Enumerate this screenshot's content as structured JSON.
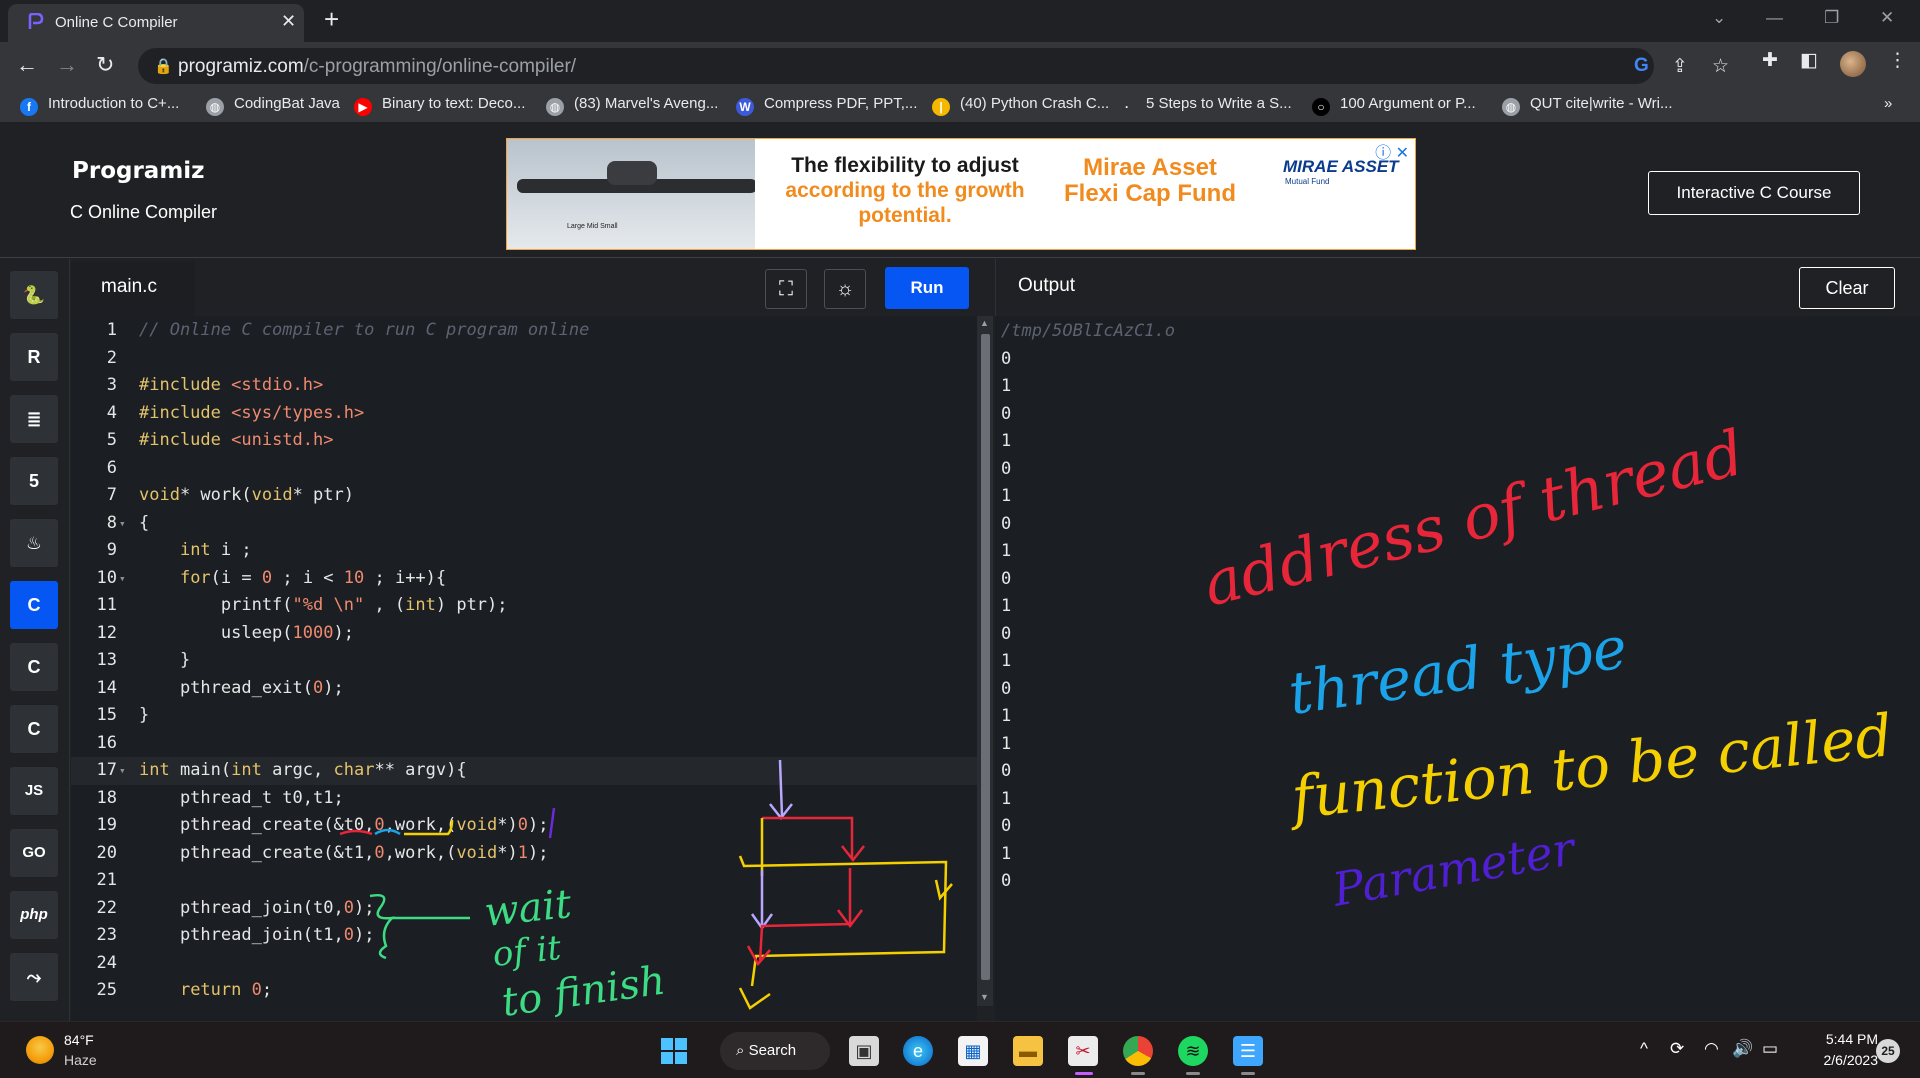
{
  "browser": {
    "tab_title": "Online C Compiler",
    "tab_close": "✕",
    "new_tab": "+",
    "url_host": "programiz.com",
    "url_path": "/c-programming/online-compiler/",
    "bookmarks": [
      {
        "label": "Introduction to C+...",
        "icon": "facebook-icon",
        "color": "#1877f2"
      },
      {
        "label": "CodingBat Java",
        "icon": "globe-icon",
        "color": "#9aa0a6"
      },
      {
        "label": "Binary to text: Deco...",
        "icon": "youtube-icon",
        "color": "#ff0000"
      },
      {
        "label": "(83) Marvel's Aveng...",
        "icon": "globe-icon",
        "color": "#9aa0a6"
      },
      {
        "label": "Compress PDF, PPT,...",
        "icon": "w-icon",
        "color": "#3b5bdb"
      },
      {
        "label": "(40) Python Crash C...",
        "icon": "bar-icon",
        "color": "#f5b700"
      },
      {
        "label": "5 Steps to Write a S...",
        "icon": "dot-icon",
        "color": "#35363a"
      },
      {
        "label": "100 Argument or P...",
        "icon": "circle-icon",
        "color": "#000000"
      },
      {
        "label": "QUT cite|write - Wri...",
        "icon": "globe-icon",
        "color": "#9aa0a6"
      }
    ],
    "bookmarks_overflow": "»"
  },
  "site": {
    "brand": "Programiz",
    "subtitle": "C Online Compiler",
    "course_button": "Interactive C Course",
    "ad": {
      "headline_1": "The flexibility to adjust",
      "headline_2": "according to the growth",
      "headline_3": "potential.",
      "fund_1": "Mirae Asset",
      "fund_2": "Flexi Cap Fund",
      "logo": "MIRAE ASSET",
      "logo_sub": "Mutual Fund",
      "cap_labels": "Large  Mid  Small"
    }
  },
  "rail": {
    "items": [
      {
        "name": "python",
        "glyph": "🐍"
      },
      {
        "name": "r",
        "glyph": "R"
      },
      {
        "name": "sql",
        "glyph": "≣"
      },
      {
        "name": "html",
        "glyph": "5"
      },
      {
        "name": "java",
        "glyph": "♨"
      },
      {
        "name": "c",
        "glyph": "C"
      },
      {
        "name": "cpp",
        "glyph": "C"
      },
      {
        "name": "csharp",
        "glyph": "C"
      },
      {
        "name": "js",
        "glyph": "JS"
      },
      {
        "name": "go",
        "glyph": "GO"
      },
      {
        "name": "php",
        "glyph": "php"
      },
      {
        "name": "swift",
        "glyph": "⤳"
      }
    ],
    "active_index": 5
  },
  "editor": {
    "file_name": "main.c",
    "run_label": "Run",
    "lines": [
      {
        "n": "1",
        "html": "<span class='cm'>// Online C compiler to run C program online</span>"
      },
      {
        "n": "2",
        "html": ""
      },
      {
        "n": "3",
        "html": "<span class='inc'>#include</span> <span class='str'>&lt;stdio.h&gt;</span>"
      },
      {
        "n": "4",
        "html": "<span class='inc'>#include</span> <span class='str'>&lt;sys/types.h&gt;</span>"
      },
      {
        "n": "5",
        "html": "<span class='inc'>#include</span> <span class='str'>&lt;unistd.h&gt;</span>"
      },
      {
        "n": "6",
        "html": ""
      },
      {
        "n": "7",
        "html": "<span class='kw'>void</span>* work(<span class='kw'>void</span>* ptr)"
      },
      {
        "n": "8",
        "html": "{",
        "fold": true
      },
      {
        "n": "9",
        "html": "    <span class='kw'>int</span> i ;"
      },
      {
        "n": "10",
        "html": "    <span class='kw'>for</span>(i = <span class='num'>0</span> ; i &lt; <span class='num'>10</span> ; i++){",
        "fold": true
      },
      {
        "n": "11",
        "html": "        printf(<span class='str'>\"%d \\n\"</span> , (<span class='kw'>int</span>) ptr);"
      },
      {
        "n": "12",
        "html": "        usleep(<span class='num'>1000</span>);"
      },
      {
        "n": "13",
        "html": "    }"
      },
      {
        "n": "14",
        "html": "    pthread_exit(<span class='num'>0</span>);"
      },
      {
        "n": "15",
        "html": "}"
      },
      {
        "n": "16",
        "html": ""
      },
      {
        "n": "17",
        "html": "<span class='kw'>int</span> main(<span class='kw'>int</span> argc, <span class='kw'>char</span>** argv){",
        "fold": true,
        "hl": true
      },
      {
        "n": "18",
        "html": "    pthread_t t0,t1;"
      },
      {
        "n": "19",
        "html": "    pthread_create(&amp;t0,<span class='num'>0</span>,work,(<span class='kw'>void</span>*)<span class='num'>0</span>);"
      },
      {
        "n": "20",
        "html": "    pthread_create(&amp;t1,<span class='num'>0</span>,work,(<span class='kw'>void</span>*)<span class='num'>1</span>);"
      },
      {
        "n": "21",
        "html": ""
      },
      {
        "n": "22",
        "html": "    pthread_join(t0,<span class='num'>0</span>);"
      },
      {
        "n": "23",
        "html": "    pthread_join(t1,<span class='num'>0</span>);"
      },
      {
        "n": "24",
        "html": ""
      },
      {
        "n": "25",
        "html": "    <span class='kw'>return</span> <span class='num'>0</span>;"
      }
    ]
  },
  "output": {
    "title": "Output",
    "clear_label": "Clear",
    "path": "/tmp/5OBlIcAzC1.o",
    "lines": [
      "0",
      "1",
      "0",
      "1",
      "0",
      "1",
      "0",
      "1",
      "0",
      "1",
      "0",
      "1",
      "0",
      "1",
      "1",
      "0",
      "1",
      "0",
      "1",
      "0"
    ]
  },
  "annotations": {
    "note_1": "address of thread",
    "note_2": "thread type",
    "note_3": "function to be called",
    "note_4": "Parameter",
    "note_5_a": "wait",
    "note_5_b": "of it",
    "note_5_c": "to finish"
  },
  "taskbar": {
    "temperature": "84°F",
    "weather": "Haze",
    "search_label": "Search",
    "time": "5:44 PM",
    "date": "2/6/2023",
    "notifications": "25"
  }
}
